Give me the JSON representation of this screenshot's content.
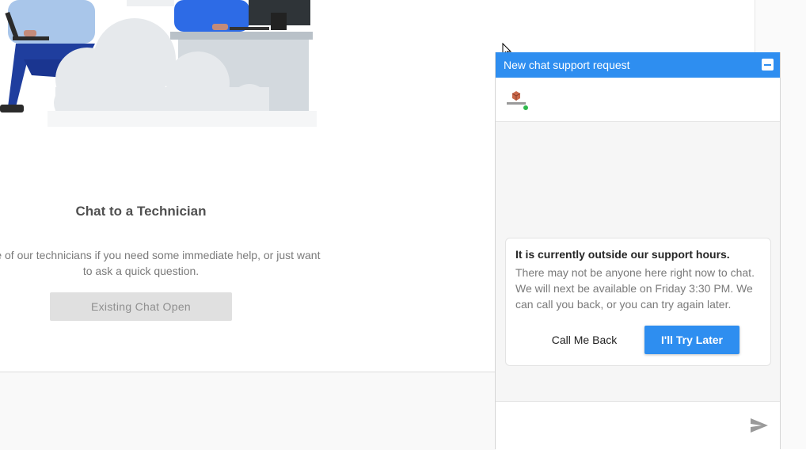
{
  "card": {
    "title": "Chat to a Technician",
    "description": "n of one of our technicians if you need some immediate help, or just want\nto ask a quick question.",
    "existing_chat_button": "Existing Chat Open"
  },
  "chat": {
    "header_title": "New chat support request",
    "agent_status_color": "#2eb84b",
    "accent_color": "#2e8ef0",
    "message": {
      "title": "It is currently outside our support hours.",
      "body": "There may not be anyone here right now to chat. We will next be available on Friday 3:30 PM. We can call you back, or you can try again later."
    },
    "actions": {
      "call_me_back": "Call Me Back",
      "try_later": "I'll Try Later"
    },
    "icons": {
      "minimize": "minimize-icon",
      "send": "send-icon",
      "logo": "company-logo"
    }
  }
}
